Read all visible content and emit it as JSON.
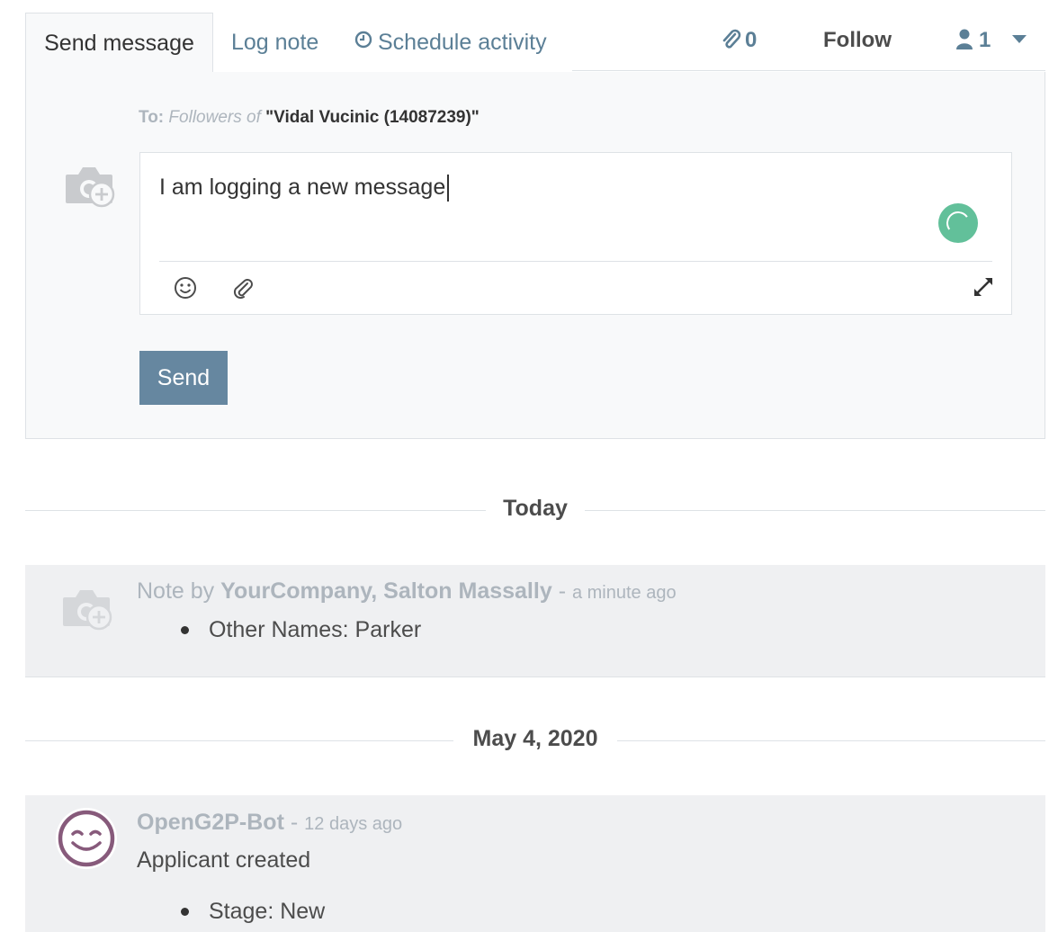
{
  "tabs": {
    "send_message": "Send message",
    "log_note": "Log note",
    "schedule_activity": "Schedule activity"
  },
  "topbar": {
    "attachments_count": "0",
    "follow_label": "Follow",
    "followers_count": "1"
  },
  "composer": {
    "to_label": "To:",
    "followers_of": "Followers of",
    "recipient": "\"Vidal Vucinic (14087239)\"",
    "body_text": "I am logging a new message",
    "send_label": "Send"
  },
  "thread": {
    "today_label": "Today",
    "note": {
      "prefix": "Note by",
      "author": "YourCompany, Salton Massally",
      "dash": "-",
      "ago": "a minute ago",
      "item": "Other Names: Parker"
    },
    "date2_label": "May 4, 2020",
    "bot": {
      "author": "OpenG2P-Bot",
      "dash": "-",
      "ago": "12 days ago",
      "body": "Applicant created",
      "item": "Stage: New"
    }
  },
  "colors": {
    "link": "#5b7f96",
    "send_button": "#6687a0",
    "spinner": "#62c09a",
    "message_bg": "#eff0f2",
    "bot_avatar": "#875a7b"
  }
}
